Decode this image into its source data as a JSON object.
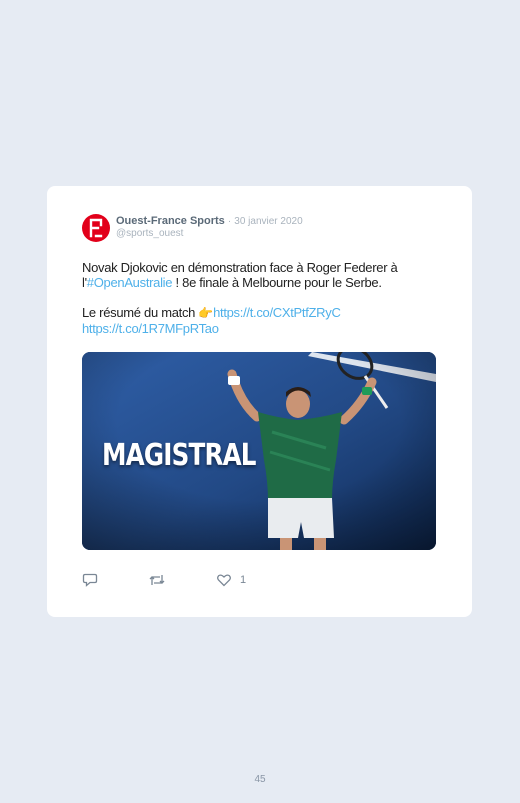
{
  "tweet": {
    "author_name": "Ouest-France Sports",
    "separator": "·",
    "date": "30 janvier 2020",
    "handle": "@sports_ouest",
    "text_line1_before": "Novak Djokovic en démonstration face à Roger Federer à l'",
    "hashtag": "#OpenAustralie",
    "text_line1_after": " ! 8e finale à Melbourne pour le Serbe.",
    "summary_label": "Le résumé du match ",
    "emoji": "👉",
    "link1": "https://t.co/CXtPtfZRyC",
    "link2": "https://t.co/1R7MFpRTao",
    "media_overlay_text": "MAGISTRAL",
    "like_count": "1"
  },
  "icons": {
    "avatar": "ouest-france-logo",
    "reply": "reply-icon",
    "retweet": "retweet-icon",
    "like": "heart-icon"
  },
  "colors": {
    "background": "#e6ebf3",
    "link": "#4eb0e9",
    "brand_red": "#e2001a"
  },
  "page": {
    "number": "45"
  }
}
